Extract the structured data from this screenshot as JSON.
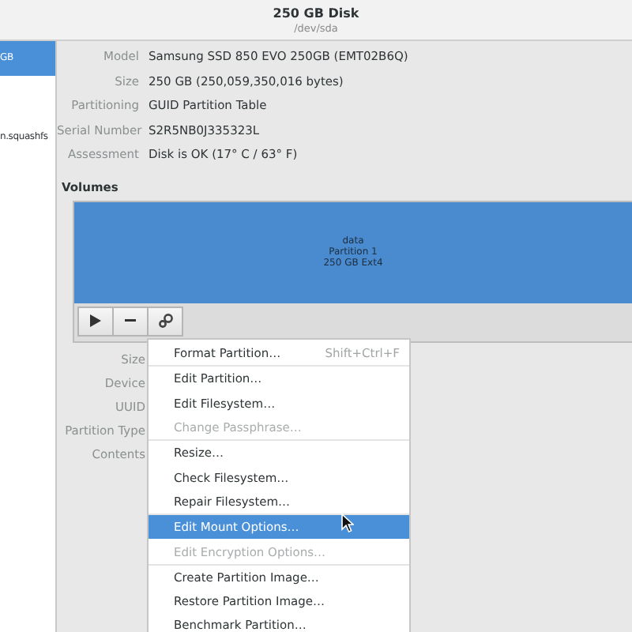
{
  "window": {
    "title": "250 GB Disk",
    "subtitle": "/dev/sda"
  },
  "sidebar": {
    "items": [
      {
        "label": "GB",
        "selected": true
      },
      {
        "label": "n.squashfs",
        "selected": false
      }
    ]
  },
  "drive_info": [
    {
      "label": "Model",
      "value": "Samsung SSD 850 EVO 250GB (EMT02B6Q)"
    },
    {
      "label": "Size",
      "value": "250 GB (250,059,350,016 bytes)"
    },
    {
      "label": "Partitioning",
      "value": "GUID Partition Table"
    },
    {
      "label": "Serial Number",
      "value": "S2R5NB0J335323L"
    },
    {
      "label": "Assessment",
      "value": "Disk is OK (17° C / 63° F)"
    }
  ],
  "volumes": {
    "heading": "Volumes",
    "partitions": [
      {
        "lines": [
          "data",
          "Partition 1",
          "250 GB Ext4"
        ],
        "selected": true
      }
    ]
  },
  "toolbar": [
    {
      "kind": "play"
    },
    {
      "kind": "minus"
    },
    {
      "kind": "gears"
    }
  ],
  "volume_info": [
    {
      "label": "Size"
    },
    {
      "label": "Device"
    },
    {
      "label": "UUID"
    },
    {
      "label": "Partition Type"
    },
    {
      "label": "Contents"
    }
  ],
  "menu": {
    "sections": [
      [
        {
          "label": "Format Partition…",
          "shortcut": "Shift+Ctrl+F",
          "disabled": false,
          "selected": false
        }
      ],
      [
        {
          "label": "Edit Partition…",
          "disabled": false,
          "selected": false
        },
        {
          "label": "Edit Filesystem…",
          "disabled": false,
          "selected": false
        },
        {
          "label": "Change Passphrase…",
          "disabled": true,
          "selected": false
        }
      ],
      [
        {
          "label": "Resize…",
          "disabled": false,
          "selected": false
        },
        {
          "label": "Check Filesystem…",
          "disabled": false,
          "selected": false
        },
        {
          "label": "Repair Filesystem…",
          "disabled": false,
          "selected": false
        }
      ],
      [
        {
          "label": "Edit Mount Options…",
          "disabled": false,
          "selected": true
        },
        {
          "label": "Edit Encryption Options…",
          "disabled": true,
          "selected": false
        }
      ],
      [
        {
          "label": "Create Partition Image…",
          "disabled": false,
          "selected": false
        },
        {
          "label": "Restore Partition Image…",
          "disabled": false,
          "selected": false
        },
        {
          "label": "Benchmark Partition…",
          "disabled": false,
          "selected": false
        }
      ]
    ]
  }
}
